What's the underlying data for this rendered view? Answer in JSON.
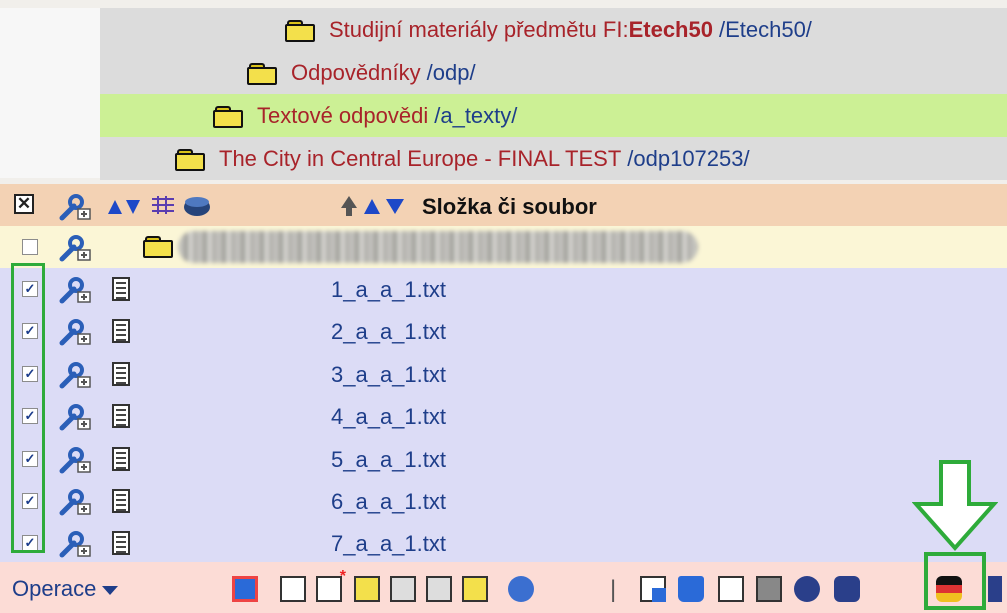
{
  "breadcrumbs": [
    {
      "name": "Studijní materiály předmětu FI:",
      "name_bold": "Etech50",
      "path": "/Etech50/"
    },
    {
      "name": "Odpovědníky",
      "path": "/odp/"
    },
    {
      "name": "Textové odpovědi",
      "path": "/a_texty/"
    },
    {
      "name": "The City in Central Europe - FINAL TEST",
      "path": "/odp107253/"
    }
  ],
  "header": {
    "label": "Složka či soubor",
    "select_all_mark": "✕"
  },
  "files": [
    {
      "name": "1_a_a_1.txt",
      "checked": true
    },
    {
      "name": "2_a_a_1.txt",
      "checked": true
    },
    {
      "name": "3_a_a_1.txt",
      "checked": true
    },
    {
      "name": "4_a_a_1.txt",
      "checked": true
    },
    {
      "name": "5_a_a_1.txt",
      "checked": true
    },
    {
      "name": "6_a_a_1.txt",
      "checked": true
    },
    {
      "name": "7_a_a_1.txt",
      "checked": true
    }
  ],
  "checkmark": "✓",
  "toolbar": {
    "operace_label": "Operace",
    "separator": "|"
  },
  "colors": {
    "highlight": "#2eab3a",
    "link": "#1e3e8a",
    "folder_name": "#a8232a"
  }
}
